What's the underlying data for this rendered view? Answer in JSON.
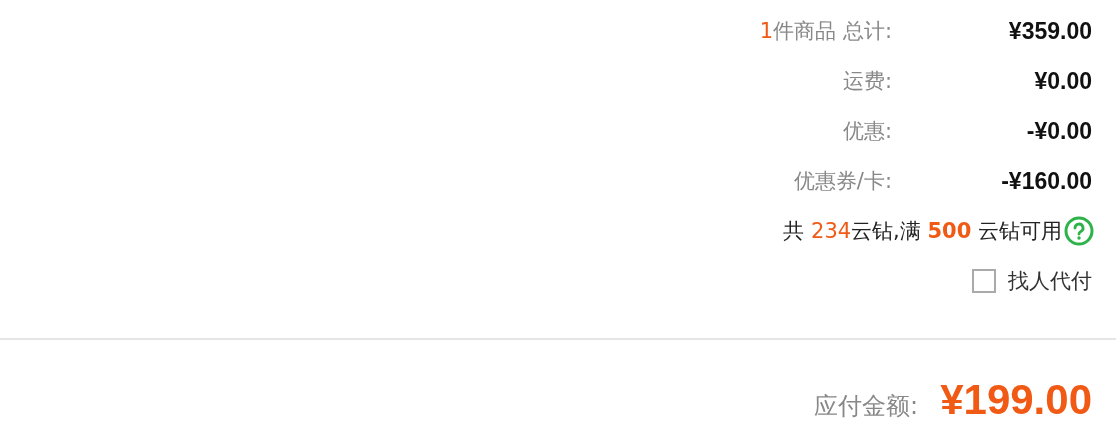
{
  "summary_rows": [
    {
      "label_parts": [
        {
          "kind": "count",
          "text": "1"
        },
        {
          "kind": "text",
          "text": "件商品 总计:"
        }
      ],
      "value": "¥359.00"
    },
    {
      "label_parts": [
        {
          "kind": "text",
          "text": "运费:"
        }
      ],
      "value": "¥0.00"
    },
    {
      "label_parts": [
        {
          "kind": "text",
          "text": "优惠:"
        }
      ],
      "value": "-¥0.00"
    },
    {
      "label_parts": [
        {
          "kind": "text",
          "text": "优惠券/卡:"
        }
      ],
      "value": "-¥160.00"
    }
  ],
  "coins_note": {
    "parts": [
      {
        "kind": "text",
        "text": "共 "
      },
      {
        "kind": "count",
        "text": "234"
      },
      {
        "kind": "text",
        "text": "云钻,满 "
      },
      {
        "kind": "threshold",
        "text": "500"
      },
      {
        "kind": "text",
        "text": " 云钻可用"
      }
    ]
  },
  "pay_for_me": {
    "label": "找人代付",
    "checked": false
  },
  "total": {
    "label": "应付金额:",
    "amount": "¥199.00"
  }
}
